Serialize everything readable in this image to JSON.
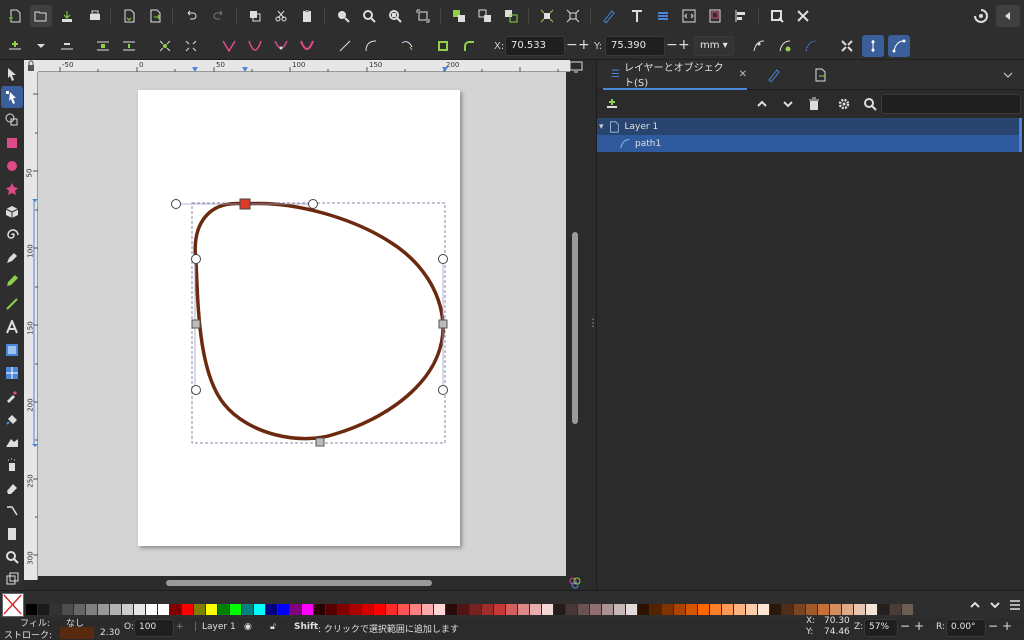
{
  "controls": {
    "x_label": "X:",
    "x_value": "70.533",
    "y_label": "Y:",
    "y_value": "75.390",
    "unit": "mm"
  },
  "rulers": {
    "h_ticks": [
      "-50",
      "0",
      "50",
      "100",
      "150",
      "200"
    ],
    "v_ticks": [
      "50",
      "100",
      "150",
      "200",
      "250",
      "300"
    ]
  },
  "dock": {
    "tab_layers": "レイヤーとオブジェクト(S)",
    "tree": [
      {
        "label": "Layer 1"
      },
      {
        "label": "path1"
      }
    ]
  },
  "palette": {
    "colors": [
      "#000000",
      "#1a1a1a",
      "#333333",
      "#4d4d4d",
      "#666666",
      "#808080",
      "#999999",
      "#b3b3b3",
      "#cccccc",
      "#e6e6e6",
      "#ffffff",
      "#ffffff",
      "#800000",
      "#ff0000",
      "#808000",
      "#ffff00",
      "#008000",
      "#00ff00",
      "#008080",
      "#00ffff",
      "#000080",
      "#0000ff",
      "#800080",
      "#ff00ff",
      "#2b0000",
      "#550000",
      "#800000",
      "#aa0000",
      "#d40000",
      "#ff0000",
      "#ff2a2a",
      "#ff5555",
      "#ff8080",
      "#ffaaaa",
      "#ffd5d5",
      "#280b0b",
      "#501616",
      "#782121",
      "#a02c2c",
      "#c83737",
      "#d35f5f",
      "#de8787",
      "#e9afaf",
      "#f4d7d7",
      "#241c1c",
      "#483737",
      "#6c5353",
      "#916f6f",
      "#ac9393",
      "#c8b7b7",
      "#e3dbdb",
      "#2b1100",
      "#552200",
      "#803300",
      "#aa4400",
      "#d45500",
      "#ff6600",
      "#ff7f2a",
      "#ff9955",
      "#ffb380",
      "#ffccaa",
      "#ffe6d5",
      "#28170b",
      "#502d16",
      "#784421",
      "#a05a2c",
      "#c87137",
      "#d38d5f",
      "#deaa87",
      "#e9c6af",
      "#f4e3d7",
      "#241f1c",
      "#483e37",
      "#6c5d53"
    ]
  },
  "status": {
    "fill_label": "フィル:",
    "fill_value": "なし",
    "stroke_label": "ストローク:",
    "stroke_width": "2.30",
    "stroke_color": "#5a2a10",
    "opacity_label": "O:",
    "opacity_value": "100",
    "layer": "Layer 1",
    "message_key": "Shift",
    "message": ": クリックで選択範囲に追加します",
    "x_label": "X:",
    "x": "70.30",
    "y_label": "Y:",
    "y": "74.46",
    "zoom_label": "Z:",
    "zoom": "57%",
    "rotation_label": "R:",
    "rotation": "0.00°"
  },
  "colors": {
    "accent": "#4a86d8",
    "path_stroke": "#6b2a10",
    "selected_node": "#e03a2a"
  }
}
